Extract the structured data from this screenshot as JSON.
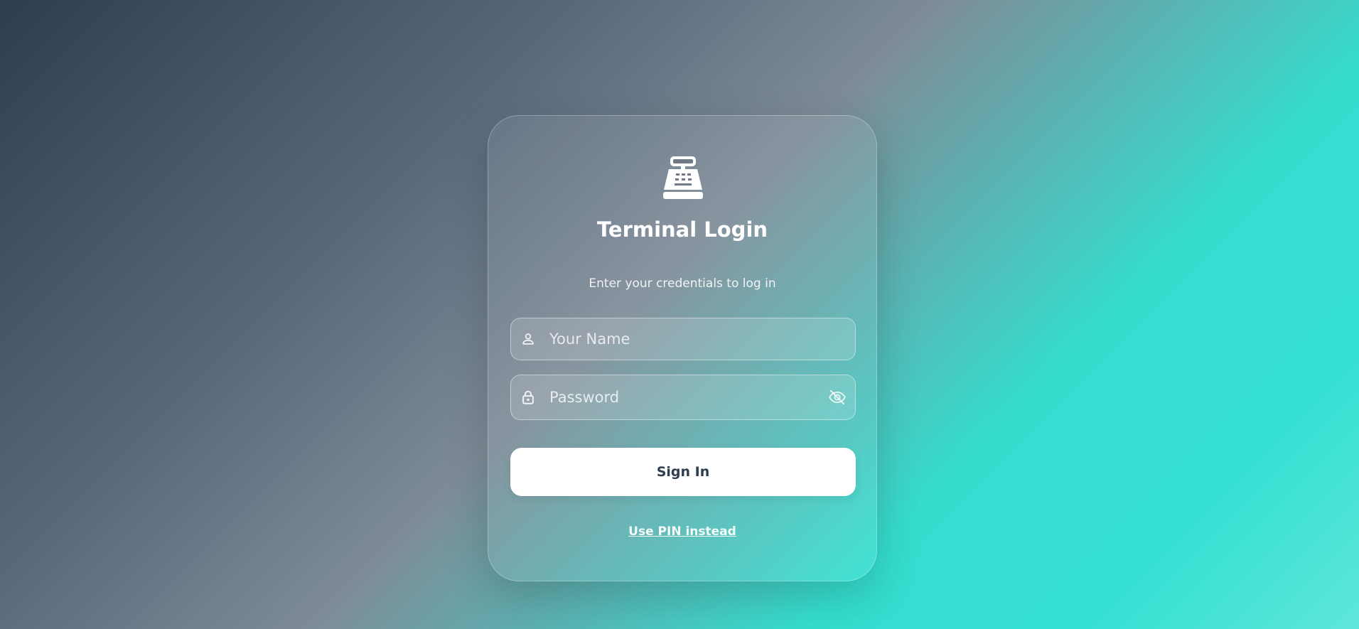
{
  "login": {
    "title": "Terminal Login",
    "subtitle": "Enter your credentials to log in",
    "logo_icon": "cash-register-icon",
    "name_field": {
      "icon": "user-icon",
      "placeholder": "Your Name",
      "value": ""
    },
    "password_field": {
      "icon": "lock-icon",
      "placeholder": "Password",
      "value": "",
      "toggle_icon": "eye-off-icon"
    },
    "sign_in_label": "Sign In",
    "pin_link_label": "Use PIN instead"
  },
  "colors": {
    "gradient_dark": "#2c3e50",
    "gradient_mid": "#7e8b97",
    "gradient_teal": "#34e0d2",
    "button_bg": "#ffffff",
    "button_text": "#2c3e50"
  }
}
